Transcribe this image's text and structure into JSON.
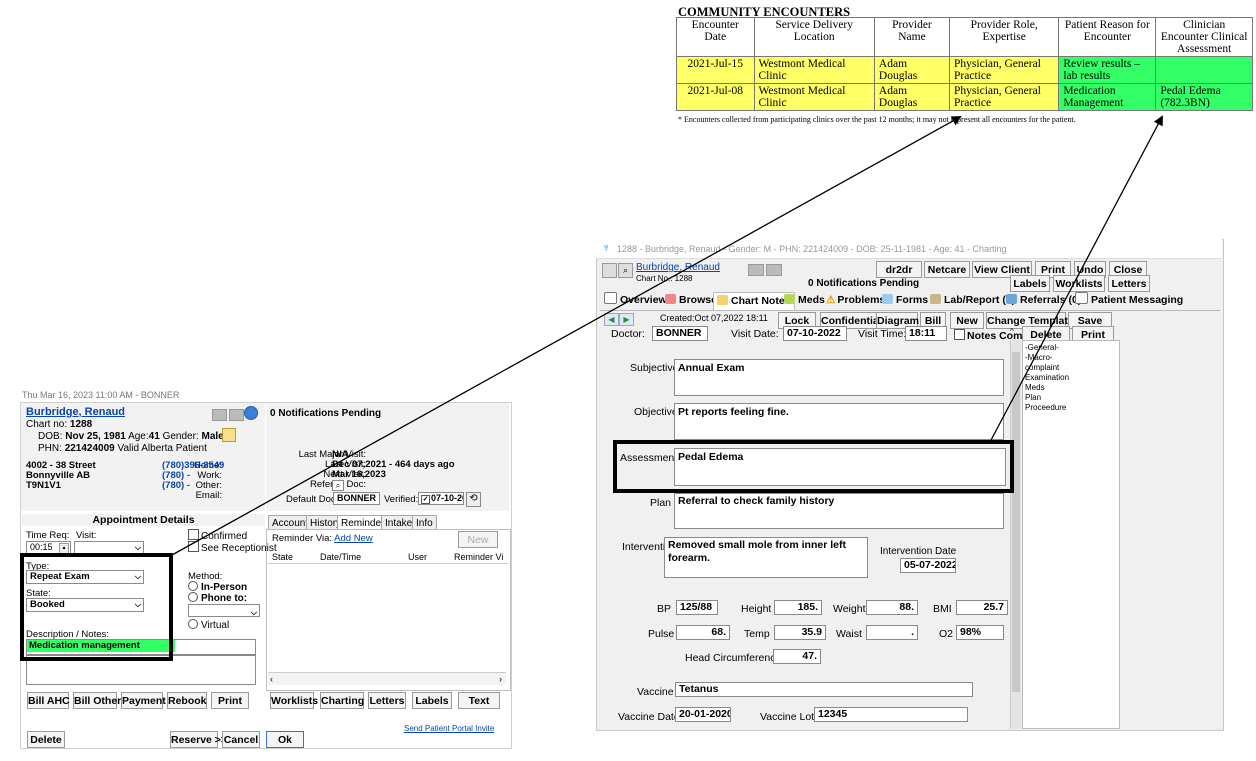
{
  "community": {
    "title": "COMMUNITY ENCOUNTERS",
    "headers": [
      "Encounter Date",
      "Service Delivery Location",
      "Provider Name",
      "Provider Role, Expertise",
      "Patient Reason for Encounter",
      "Clinician Encounter Clinical Assessment"
    ],
    "rows": [
      [
        "2021-Jul-15",
        "Westmont Medical Clinic",
        "Adam Douglas",
        "Physician, General Practice",
        "Review results – lab results",
        ""
      ],
      [
        "2021-Jul-08",
        "Westmont Medical Clinic",
        "Adam Douglas",
        "Physician, General Practice",
        "Medication Management",
        "Pedal Edema (782.3BN)"
      ]
    ],
    "footnote": "* Encounters collected from participating clinics over the past 12 months; it may not represent all encounters for the patient."
  },
  "appt": {
    "window_title": "Thu Mar 16, 2023  11:00 AM - BONNER",
    "patient_name": "Burbridge, Renaud",
    "chart_no_label": "Chart no:",
    "chart_no": "1288",
    "dob_label": "DOB:",
    "dob": "Nov 25, 1981",
    "age_label": "Age:",
    "age": "41",
    "gender_label": "Gender:",
    "gender": "Male",
    "phn_label": "PHN:",
    "phn": "221424009",
    "phn_status": "Valid Alberta Patient",
    "address1": "4002 - 38 Street",
    "address2": "Bonnyville  AB",
    "address3": "T9N1V1",
    "home_label": "Home:",
    "home": "(780)396-8549",
    "work_label": "Work:",
    "work": "(780)  -",
    "other_label": "Other:",
    "other": "(780)  -",
    "email_label": "Email:",
    "notifications": "0 Notifications Pending",
    "last_major_label": "Last Major Visit:",
    "last_major": "N/A",
    "last_visit_label": "Last Visit:",
    "last_visit": "Dec 07,2021 - 464 days ago",
    "next_visit_label": "Next Visit:",
    "next_visit": "Mar 16,2023",
    "referral_doc_label": "Referral Doc:",
    "default_doc_label": "Default Doc:",
    "default_doc": "BONNER",
    "verified_label": "Verified:",
    "verified_date": "07-10-2022",
    "section_title": "Appointment Details",
    "time_req_label": "Time Req:",
    "time_req": "00:15",
    "visit_label": "Visit:",
    "confirmed": "Confirmed",
    "see_receptionist": "See Receptionist",
    "type_label": "Type:",
    "type_value": "Repeat Exam",
    "method_label": "Method:",
    "in_person": "In-Person",
    "phone_to": "Phone to:",
    "virtual": "Virtual",
    "state_label": "State:",
    "state_value": "Booked",
    "desc_label": "Description / Notes:",
    "desc_value": "Medication management",
    "tabs": [
      "Accounts",
      "History",
      "Reminders",
      "Intake",
      "Info"
    ],
    "reminder_via": "Reminder Via:",
    "add_new": "Add New",
    "new_btn": "New",
    "rem_cols": [
      "State",
      "Date/Time",
      "User",
      "Reminder Vi"
    ],
    "buttons_left": [
      "Bill AHC",
      "Bill Other",
      "Payment",
      "Rebook",
      "Print"
    ],
    "buttons_right": [
      "Worklists",
      "Charting",
      "Letters",
      "Labels",
      "Text"
    ],
    "portal_link": "Send Patient Portal Invite",
    "delete": "Delete",
    "reserve": "Reserve >>",
    "cancel": "Cancel",
    "ok": "Ok"
  },
  "chart": {
    "window_title": "1288 - Burbridge, Renaud - Gender: M - PHN: 221424009 - DOB: 25-11-1981 - Age: 41 - Charting",
    "patient_name": "Burbridge, Renaud",
    "chart_no": "Chart No.: 1288",
    "notifications": "0 Notifications Pending",
    "top_buttons": [
      "dr2dr",
      "Netcare",
      "View Client",
      "Print",
      "Undo",
      "Close"
    ],
    "second_buttons": [
      "Labels",
      "Worklists",
      "Letters"
    ],
    "tabs": [
      "Overview",
      "Browse",
      "Chart Notes",
      "Meds",
      "Problems",
      "Forms",
      "Lab/Report (0)",
      "Referrals (0)",
      "Patient Messaging"
    ],
    "created": "Created:Oct 07,2022 18:11",
    "toolbar": [
      "Lock",
      "Confidential",
      "Diagram",
      "Bill",
      "New",
      "Change Template",
      "Save"
    ],
    "doctor_label": "Doctor:",
    "doctor": "BONNER",
    "visit_date_label": "Visit Date:",
    "visit_date": "07-10-2022",
    "visit_time_label": "Visit Time:",
    "visit_time": "18:11",
    "notes_complete": "Notes Complete",
    "delete": "Delete",
    "print": "Print",
    "template_items": [
      "-General-",
      "-Macro-",
      "complaint",
      "Examination",
      "Meds",
      "Plan",
      "Proceedure"
    ],
    "subjective_label": "Subjective",
    "subjective": "Annual Exam",
    "objective_label": "Objective",
    "objective": "Pt reports feeling fine.",
    "assessment_label": "Assessment",
    "assessment": "Pedal Edema",
    "plan_label": "Plan",
    "plan": "Referral to check family history",
    "intervention_label": "Intervention",
    "intervention": "Removed small mole from inner left forearm.",
    "intervention_date_label": "Intervention Date",
    "intervention_date": "05-07-2022",
    "bp_label": "BP",
    "bp": "125/88",
    "height_label": "Height",
    "height": "185.",
    "weight_label": "Weight",
    "weight": "88.",
    "bmi_label": "BMI",
    "bmi": "25.7",
    "pulse_label": "Pulse",
    "pulse": "68.",
    "temp_label": "Temp",
    "temp": "35.9",
    "waist_label": "Waist",
    "waist": ".",
    "o2_label": "O2",
    "o2": "98%",
    "head_label": "Head Circumference",
    "head": "47.",
    "vaccine_label": "Vaccine",
    "vaccine": "Tetanus",
    "vaccine_date_label": "Vaccine Date",
    "vaccine_date": "20-01-2020",
    "vaccine_lot_label": "Vaccine Lot #",
    "vaccine_lot": "12345"
  },
  "colors": {
    "highlight_green": "#33ff66",
    "highlight_yellow": "#ffff66",
    "link_blue": "#0645ad"
  }
}
